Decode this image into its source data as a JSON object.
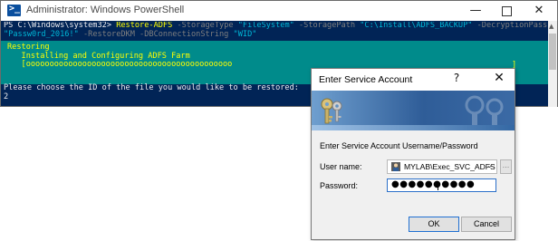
{
  "window": {
    "title": "Administrator: Windows PowerShell",
    "minimize_glyph": "—",
    "close_glyph": "✕"
  },
  "console": {
    "line1_prompt": "PS C:\\Windows\\system32> ",
    "line1_cmd": "Restore-ADFS",
    "line1_p1": " -StorageType ",
    "line1_v1": "\"FileSystem\"",
    "line1_p2": " -StoragePath ",
    "line1_v2": "\"C:\\Install\\ADFS_BACKUP\"",
    "line1_p3": " -DecryptionPassword",
    "line2_v3": "\"Passw0rd_2016!\"",
    "line2_p4": " -RestoreDKM -DBConnectionString ",
    "line2_v4": "\"WID\"",
    "progress_line1": "Restoring",
    "progress_line2": "   Installing and Configuring ADFS Farm",
    "progress_line3": "   [oooooooooooooooooooooooooooooooooooooooooooo",
    "progress_end": "]",
    "prompt_line1": "Please choose the ID of the file you would like to be restored:",
    "prompt_line2": "2"
  },
  "dialog": {
    "title": "Enter Service Account",
    "help_glyph": "?",
    "close_glyph": "✕",
    "instruction": "Enter Service Account Username/Password",
    "username_label": "User name:",
    "username_value": "MYLAB\\Exec_SVC_ADFS",
    "password_label": "Password:",
    "password_value": "●●●●●●●●●●",
    "browse_label": "...",
    "ok_label": "OK",
    "cancel_label": "Cancel"
  },
  "colors": {
    "console_bg": "#012456",
    "progress_bg": "#008b8b",
    "command_yellow": "#ffff00",
    "param_gray": "#7f7f7f",
    "string_cyan": "#00b7d7"
  }
}
